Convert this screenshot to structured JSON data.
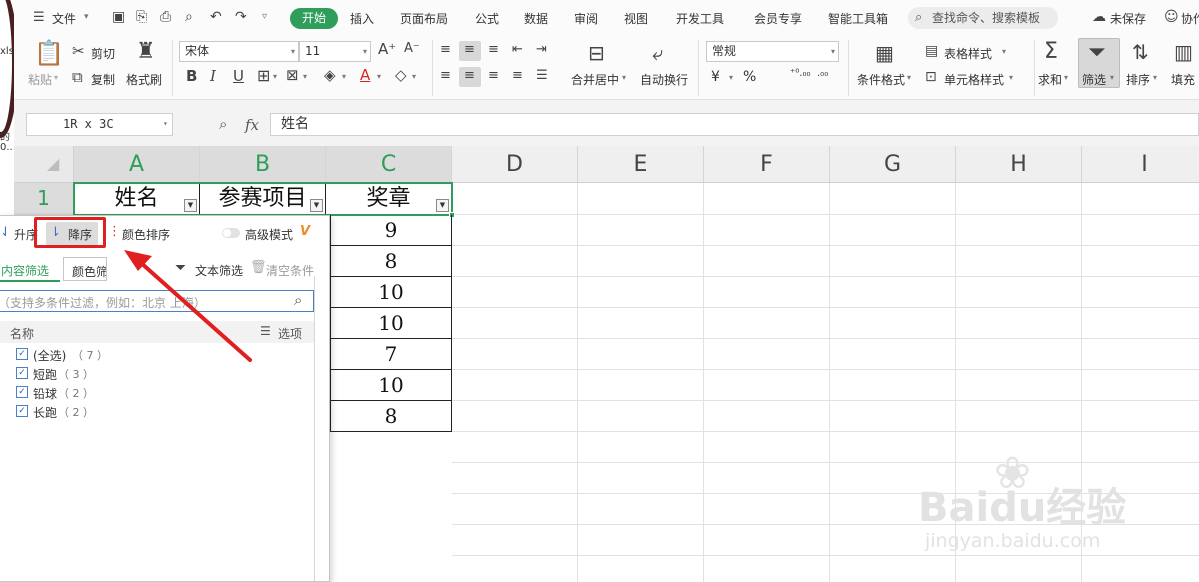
{
  "menu": {
    "file": "文件",
    "tabs": [
      "开始",
      "插入",
      "页面布局",
      "公式",
      "数据",
      "审阅",
      "视图",
      "开发工具",
      "会员专享",
      "智能工具箱"
    ],
    "search": "查找命令、搜索模板",
    "unsaved": "未保存",
    "collab": "协作"
  },
  "ribbon": {
    "paste": "粘贴",
    "cut": "剪切",
    "copy": "复制",
    "format_painter": "格式刷",
    "font_name": "宋体",
    "font_size": "11",
    "merge_center": "合并居中",
    "wrap_text": "自动换行",
    "number_format": "常规",
    "currency": "¥",
    "percent": "%",
    "inc_decimal": "⁺⁰.₀₀",
    "dec_decimal": ".₀₀",
    "cond_format": "条件格式",
    "table_style": "表格样式",
    "cell_style": "单元格样式",
    "sum": "求和",
    "filter": "筛选",
    "sort": "排序",
    "fill": "填充"
  },
  "formula": {
    "name_box": "1R x 3C",
    "fx": "fx",
    "content": "姓名"
  },
  "sheet": {
    "columns": [
      "A",
      "B",
      "C",
      "D",
      "E",
      "F",
      "G",
      "H",
      "I"
    ],
    "row1": "1",
    "headers": [
      "姓名",
      "参赛项目",
      "奖章"
    ],
    "medals": [
      "9",
      "8",
      "10",
      "10",
      "7",
      "10",
      "8"
    ]
  },
  "filter_panel": {
    "asc": "升序",
    "desc": "降序",
    "color_sort": "颜色排序",
    "advanced": "高级模式",
    "content_filter": "内容筛选",
    "color_filter": "颜色筛选",
    "text_filter": "文本筛选",
    "clear": "清空条件",
    "placeholder": "（支持多条件过滤，例如：北京  上海）",
    "list_header": "名称",
    "options": "选项",
    "items": [
      {
        "label": "(全选)",
        "count": "（ 7 ）"
      },
      {
        "label": "短跑",
        "count": "（ 3 ）"
      },
      {
        "label": "铅球",
        "count": "（ 2 ）"
      },
      {
        "label": "长跑",
        "count": "（ 2 ）"
      }
    ]
  },
  "left_strip": {
    "t1": "xls",
    "t2": "的",
    "t3": "0..."
  },
  "watermark": {
    "logo": "Baidu经验",
    "url": "jingyan.baidu.com"
  },
  "colors": {
    "accent": "#2e9e5a",
    "annotation": "#e02020"
  }
}
